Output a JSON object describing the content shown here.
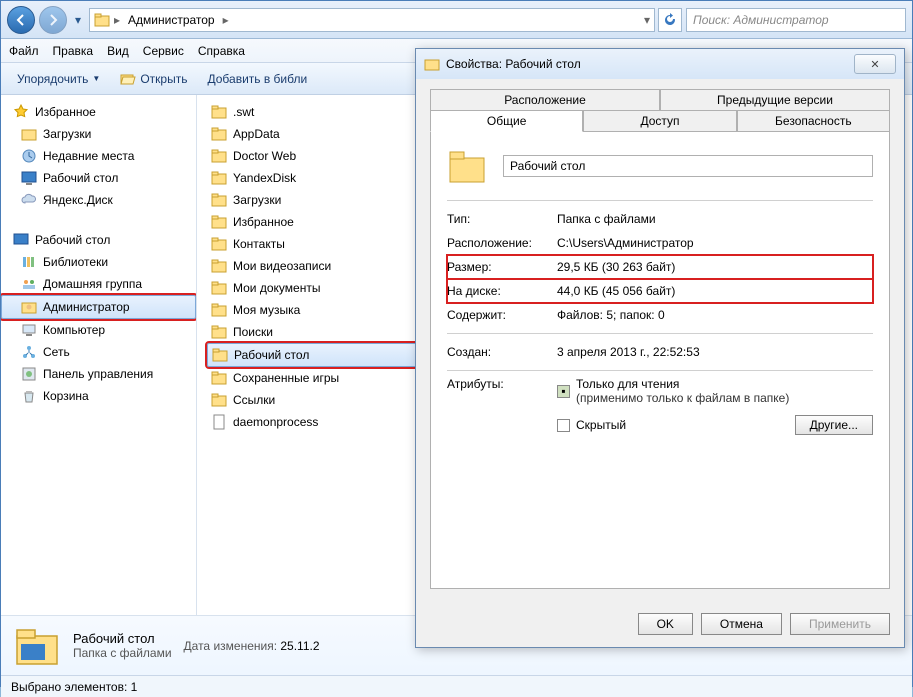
{
  "nav": {
    "breadcrumb": [
      "Администратор"
    ],
    "search_placeholder": "Поиск: Администратор"
  },
  "menu": {
    "file": "Файл",
    "edit": "Правка",
    "view": "Вид",
    "tools": "Сервис",
    "help": "Справка"
  },
  "toolbar": {
    "organize": "Упорядочить",
    "open": "Открыть",
    "add_lib": "Добавить в библи"
  },
  "sidebar": {
    "favorites": {
      "title": "Избранное",
      "items": [
        "Загрузки",
        "Недавние места",
        "Рабочий стол",
        "Яндекс.Диск"
      ]
    },
    "desktop": {
      "title": "Рабочий стол",
      "items": [
        "Библиотеки",
        "Домашняя группа",
        "Администратор",
        "Компьютер",
        "Сеть",
        "Панель управления",
        "Корзина"
      ],
      "selected_index": 2
    }
  },
  "files": {
    "items": [
      ".swt",
      "AppData",
      "Doctor Web",
      "YandexDisk",
      "Загрузки",
      "Избранное",
      "Контакты",
      "Мои видеозаписи",
      "Мои документы",
      "Моя музыка",
      "Поиски",
      "Рабочий стол",
      "Сохраненные игры",
      "Ссылки",
      "daemonprocess"
    ],
    "selected_index": 11
  },
  "details": {
    "name": "Рабочий стол",
    "type": "Папка с файлами",
    "modified_label": "Дата изменения:",
    "modified": "25.11.2"
  },
  "status": {
    "text": "Выбрано элементов: 1"
  },
  "dialog": {
    "title": "Свойства: Рабочий стол",
    "tabs_top": [
      "Расположение",
      "Предыдущие версии"
    ],
    "tabs_bot": [
      "Общие",
      "Доступ",
      "Безопасность"
    ],
    "active_tab": "Общие",
    "name": "Рабочий стол",
    "rows": {
      "type_lbl": "Тип:",
      "type_val": "Папка с файлами",
      "loc_lbl": "Расположение:",
      "loc_val": "C:\\Users\\Администратор",
      "size_lbl": "Размер:",
      "size_val": "29,5 КБ (30 263 байт)",
      "disk_lbl": "На диске:",
      "disk_val": "44,0 КБ (45 056 байт)",
      "cont_lbl": "Содержит:",
      "cont_val": "Файлов: 5; папок: 0",
      "created_lbl": "Создан:",
      "created_val": "3 апреля 2013 г., 22:52:53",
      "attr_lbl": "Атрибуты:",
      "readonly": "Только для чтения",
      "readonly_note": "(применимо только к файлам в папке)",
      "hidden": "Скрытый",
      "other": "Другие..."
    },
    "buttons": {
      "ok": "OK",
      "cancel": "Отмена",
      "apply": "Применить"
    }
  }
}
